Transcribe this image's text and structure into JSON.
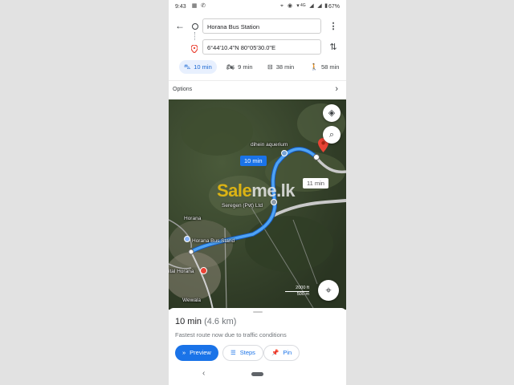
{
  "status_bar": {
    "time": "9:43",
    "network": "4G",
    "battery": "67%"
  },
  "directions": {
    "origin": "Horana Bus Station",
    "destination": "6°44'10.4\"N 80°05'30.0\"E",
    "modes": [
      {
        "name": "drive",
        "icon": "car-icon",
        "time": "10 min",
        "active": true
      },
      {
        "name": "motorcycle",
        "icon": "motorcycle-icon",
        "time": "9 min",
        "active": false
      },
      {
        "name": "transit",
        "icon": "bus-icon",
        "time": "38 min",
        "active": false
      },
      {
        "name": "walk",
        "icon": "walking-icon",
        "time": "58 min",
        "active": false
      }
    ],
    "options_label": "Options"
  },
  "map": {
    "labels": {
      "aquarium": "dihein aquerium",
      "seregen": "Seregen (Pvt) Ltd",
      "town": "Horana",
      "bus_stand": "Horana Bus Stand",
      "hospital": "ital Horana",
      "wewala": "Wewala"
    },
    "route_badge": "10 min",
    "alt_badge": "11 min",
    "watermark": {
      "part1": "Sale",
      "part2": "me.lk"
    },
    "scale": {
      "ft": "2000 ft",
      "m": "500 m"
    },
    "colors": {
      "route": "#1a73e8",
      "pin": "#ea4335"
    }
  },
  "sheet": {
    "duration": "10 min",
    "distance": "(4.6 km)",
    "note": "Fastest route now due to traffic conditions",
    "preview_label": "Preview",
    "steps_label": "Steps",
    "pin_label": "Pin"
  }
}
